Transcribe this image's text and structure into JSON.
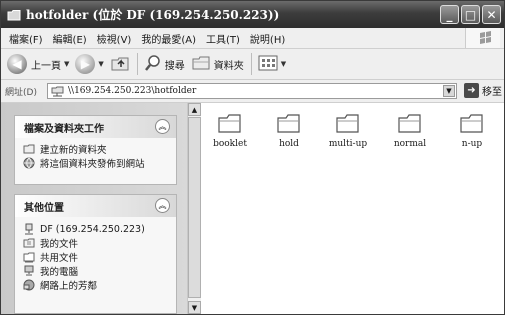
{
  "window": {
    "title": "hotfolder (位於 DF (169.254.250.223))",
    "buttons": {
      "minimize": "_",
      "maximize": "□",
      "close": "✕"
    }
  },
  "menu": [
    "檔案(F)",
    "編輯(E)",
    "檢視(V)",
    "我的最愛(A)",
    "工具(T)",
    "說明(H)"
  ],
  "toolbar": {
    "back_label": "上一頁",
    "search_label": "搜尋",
    "folders_label": "資料夾"
  },
  "address": {
    "label": "網址(D)",
    "value": "\\\\169.254.250.223\\hotfolder",
    "go_label": "移至"
  },
  "tasks_panel": {
    "title": "檔案及資料夾工作",
    "items": [
      "建立新的資料夾",
      "將這個資料夾發佈到網站"
    ]
  },
  "places_panel": {
    "title": "其他位置",
    "items": [
      "DF (169.254.250.223)",
      "我的文件",
      "共用文件",
      "我的電腦",
      "網路上的芳鄰"
    ]
  },
  "folders": [
    "booklet",
    "hold",
    "multi-up",
    "normal",
    "n-up"
  ],
  "colors": {
    "titlebar": "#3c3c3c",
    "pane": "#d0d0d0"
  }
}
